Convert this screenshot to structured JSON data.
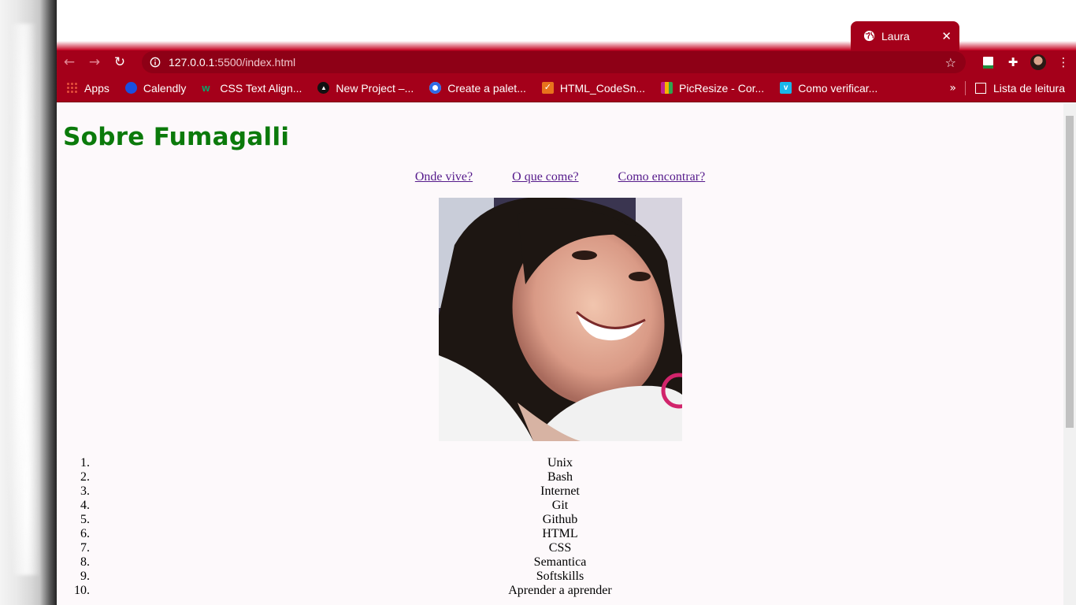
{
  "browser": {
    "tab": {
      "title": "Laura"
    },
    "url": {
      "host": "127.0.0.1",
      "path": ":5500/index.html"
    },
    "bookmarks": [
      {
        "label": "Apps",
        "icon": "apps-grid-icon",
        "color": "#e8453c"
      },
      {
        "label": "Calendly",
        "icon": "calendly-icon",
        "color": "#1a4fe0"
      },
      {
        "label": "CSS Text Align...",
        "icon": "w3schools-icon",
        "color": "#04aa6d"
      },
      {
        "label": "New Project –...",
        "icon": "triangle-icon",
        "color": "#111111"
      },
      {
        "label": "Create a palet...",
        "icon": "coolors-icon",
        "color": "#2e6be6"
      },
      {
        "label": "HTML_CodeSn...",
        "icon": "check-icon",
        "color": "#e8731c"
      },
      {
        "label": "PicResize - Cor...",
        "icon": "picresize-icon",
        "color": "#c21f8f"
      },
      {
        "label": "Como verificar...",
        "icon": "vimeo-icon",
        "color": "#1ab7ea"
      }
    ],
    "bookmarks_more": "»",
    "reading_list": "Lista de leitura"
  },
  "page": {
    "title": "Sobre Fumagalli",
    "links": [
      "Onde vive?",
      "O que come?",
      "Como encontrar?"
    ],
    "skills": [
      "Unix",
      "Bash",
      "Internet",
      "Git",
      "Github",
      "HTML",
      "CSS",
      "Semantica",
      "Softskills",
      "Aprender a aprender"
    ]
  },
  "colors": {
    "browser_theme": "#a4001a",
    "heading": "#0b7a0b",
    "link_visited": "#551a8b",
    "page_bg": "#fdf9fb"
  }
}
